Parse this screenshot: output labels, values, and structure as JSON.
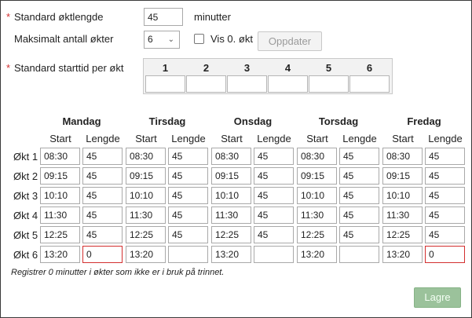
{
  "settings": {
    "session_length_label": "Standard øktlengde",
    "session_length_value": "45",
    "session_length_unit": "minutter",
    "max_sessions_label": "Maksimalt antall økter",
    "max_sessions_value": "6",
    "show_zero_label": "Vis 0. økt",
    "update_button": "Oppdater",
    "start_time_label": "Standard starttid per økt",
    "session_numbers": [
      "1",
      "2",
      "3",
      "4",
      "5",
      "6"
    ]
  },
  "schedule": {
    "days": [
      "Mandag",
      "Tirsdag",
      "Onsdag",
      "Torsdag",
      "Fredag"
    ],
    "start_label": "Start",
    "length_label": "Lengde",
    "rows": [
      {
        "label": "Økt 1",
        "start": "08:30",
        "length": [
          "45",
          "45",
          "45",
          "45",
          "45"
        ]
      },
      {
        "label": "Økt 2",
        "start": "09:15",
        "length": [
          "45",
          "45",
          "45",
          "45",
          "45"
        ]
      },
      {
        "label": "Økt 3",
        "start": "10:10",
        "length": [
          "45",
          "45",
          "45",
          "45",
          "45"
        ]
      },
      {
        "label": "Økt 4",
        "start": "11:30",
        "length": [
          "45",
          "45",
          "45",
          "45",
          "45"
        ]
      },
      {
        "label": "Økt 5",
        "start": "12:25",
        "length": [
          "45",
          "45",
          "45",
          "45",
          "45"
        ]
      },
      {
        "label": "Økt 6",
        "start": "13:20",
        "length": [
          "0",
          "",
          "",
          "",
          "0"
        ]
      }
    ],
    "note": "Registrer 0 minutter i økter som ikke er i bruk på trinnet."
  },
  "footer": {
    "save_button": "Lagre"
  },
  "colors": {
    "required": "#d32f2f",
    "error_border": "#d32f2f",
    "save_bg": "#9bc29b"
  }
}
